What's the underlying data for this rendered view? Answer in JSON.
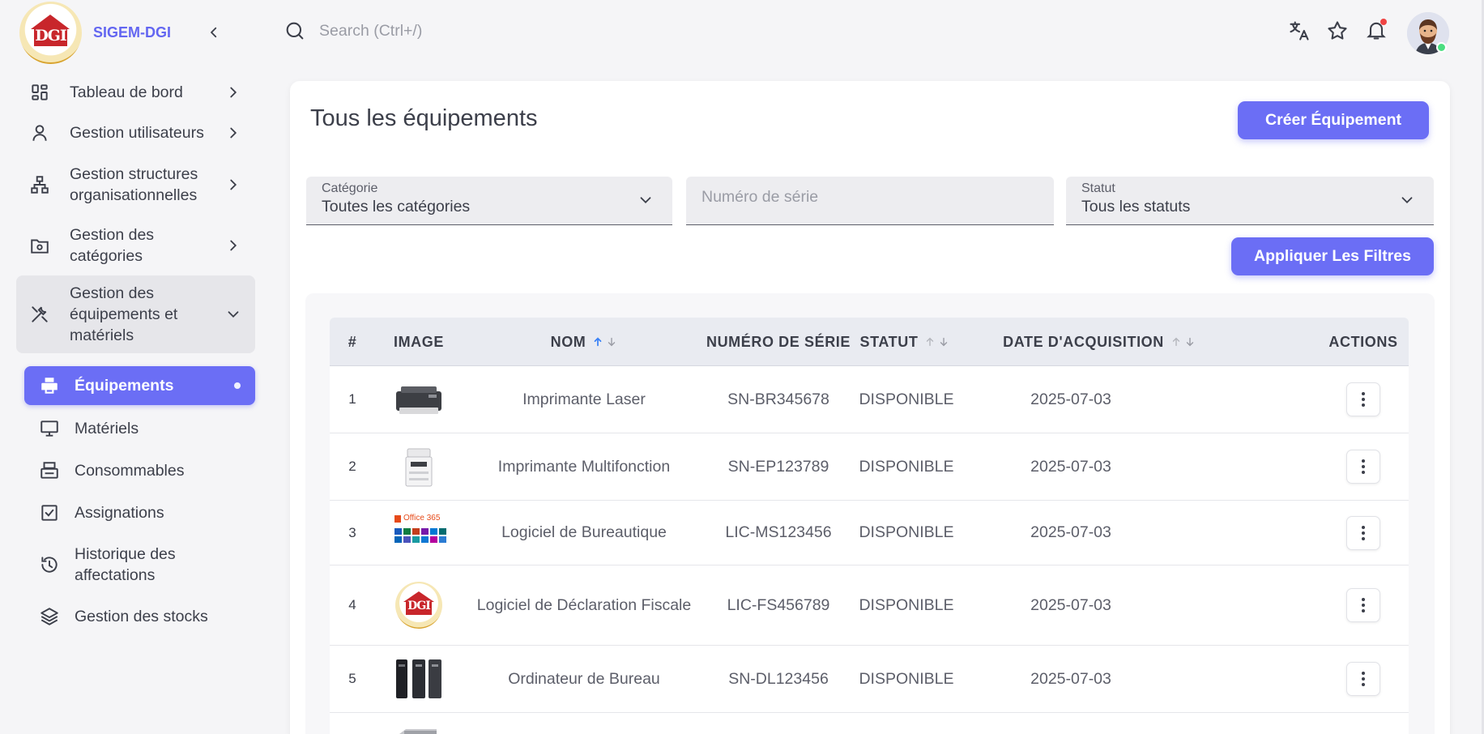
{
  "brand": {
    "name": "SIGEM-DGI",
    "logo_text": "DGI"
  },
  "search": {
    "placeholder": "Search (Ctrl+/)"
  },
  "topbar": {
    "icons": [
      "translate-icon",
      "star-icon",
      "bell-icon"
    ],
    "has_notification": true
  },
  "sidebar": {
    "items": [
      {
        "label": "Tableau de bord",
        "icon": "dashboard-icon"
      },
      {
        "label": "Gestion utilisateurs",
        "icon": "user-icon"
      },
      {
        "label": "Gestion structures organisationnelles",
        "icon": "hierarchy-icon"
      },
      {
        "label": "Gestion des catégories",
        "icon": "folder-cog-icon"
      },
      {
        "label": "Gestion des équipements et matériels",
        "icon": "tools-icon"
      }
    ],
    "subitems": [
      {
        "label": "Équipements",
        "icon": "printer-icon"
      },
      {
        "label": "Matériels",
        "icon": "monitor-icon"
      },
      {
        "label": "Consommables",
        "icon": "ink-icon"
      },
      {
        "label": "Assignations",
        "icon": "checkbox-icon"
      },
      {
        "label": "Historique des affectations",
        "icon": "history-icon"
      },
      {
        "label": "Gestion des stocks",
        "icon": "layers-icon"
      }
    ]
  },
  "page": {
    "title": "Tous les équipements",
    "create_button": "Créer Équipement",
    "apply_button": "Appliquer Les Filtres"
  },
  "filters": {
    "category": {
      "label": "Catégorie",
      "value": "Toutes les catégories"
    },
    "serial": {
      "placeholder": "Numéro de série"
    },
    "status": {
      "label": "Statut",
      "value": "Tous les statuts"
    }
  },
  "table": {
    "columns": [
      "#",
      "IMAGE",
      "NOM",
      "NUMÉRO DE SÉRIE",
      "STATUT",
      "DATE D'ACQUISITION",
      "ACTIONS"
    ],
    "rows": [
      {
        "num": "1",
        "image": "laser-printer",
        "name": "Imprimante Laser",
        "serial": "SN-BR345678",
        "status": "DISPONIBLE",
        "date": "2025-07-03"
      },
      {
        "num": "2",
        "image": "multifunction-printer",
        "name": "Imprimante Multifonction",
        "serial": "SN-EP123789",
        "status": "DISPONIBLE",
        "date": "2025-07-03"
      },
      {
        "num": "3",
        "image": "office365",
        "name": "Logiciel de Bureautique",
        "serial": "LIC-MS123456",
        "status": "DISPONIBLE",
        "date": "2025-07-03",
        "image_text": "Office 365"
      },
      {
        "num": "4",
        "image": "dgi-logo",
        "name": "Logiciel de Déclaration Fiscale",
        "serial": "LIC-FS456789",
        "status": "DISPONIBLE",
        "date": "2025-07-03",
        "image_text": "DGI"
      },
      {
        "num": "5",
        "image": "desktop-towers",
        "name": "Ordinateur de Bureau",
        "serial": "SN-DL123456",
        "status": "DISPONIBLE",
        "date": "2025-07-03"
      }
    ]
  },
  "colors": {
    "accent": "#6b6ef5",
    "sort_active": "#3b82f6",
    "online": "#4ade80",
    "notification": "#ef4444"
  }
}
